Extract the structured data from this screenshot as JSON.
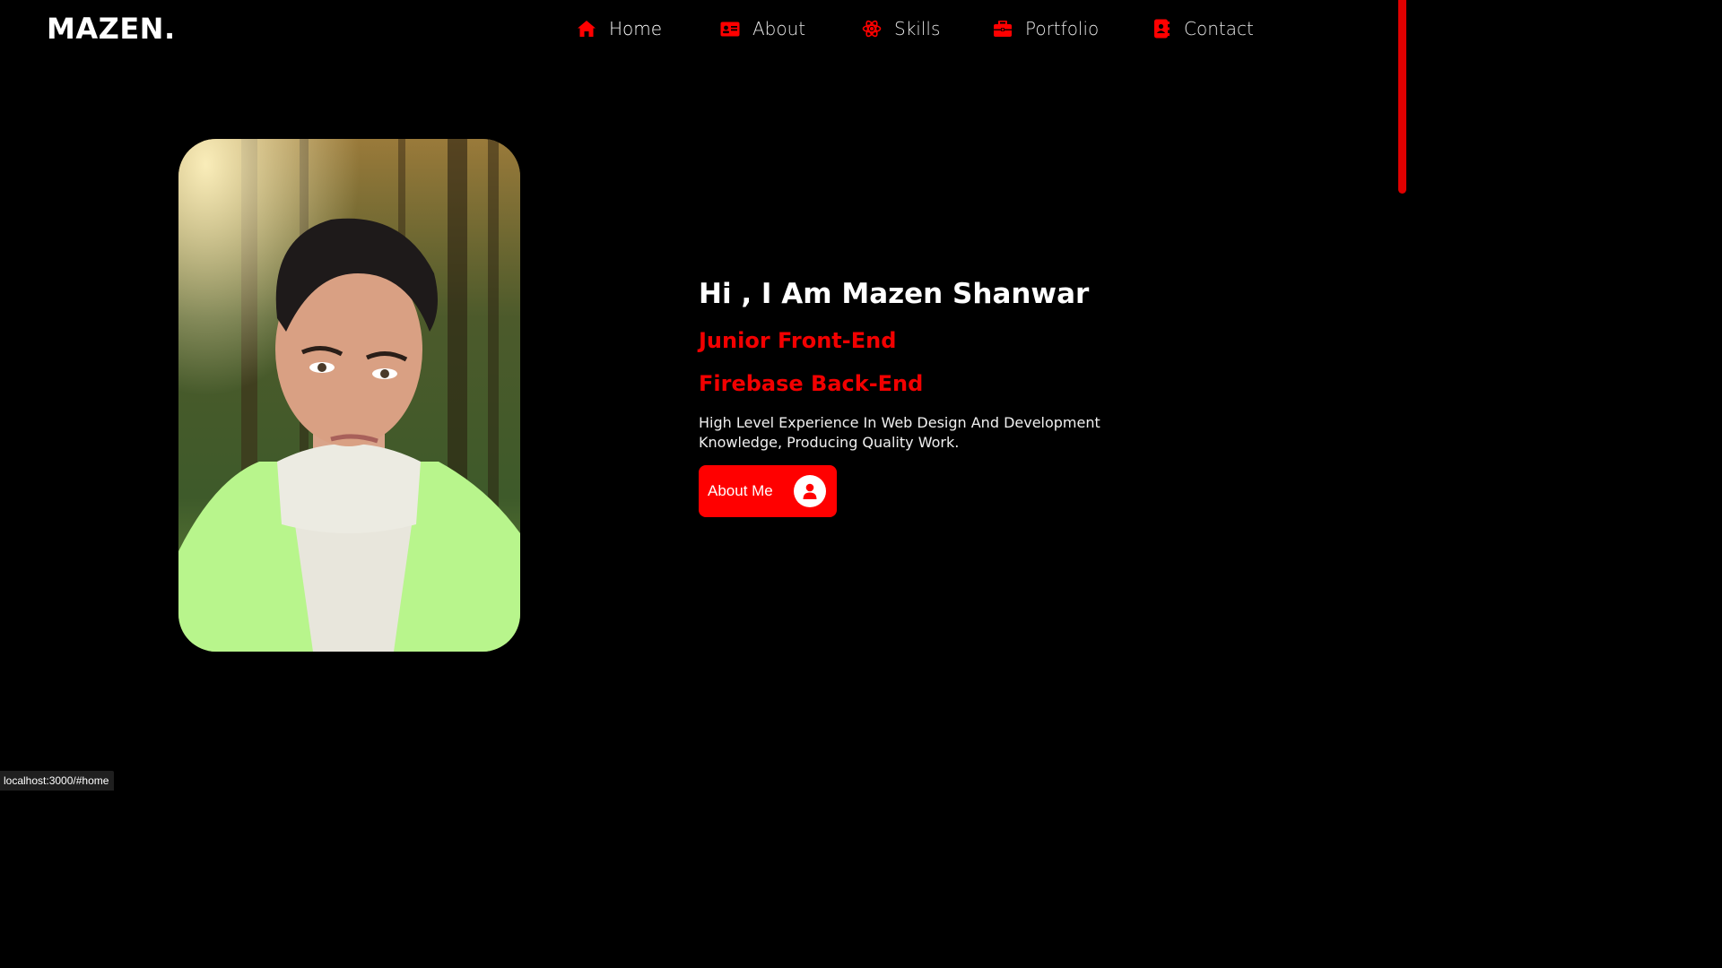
{
  "brand": {
    "logo": "MAZEN."
  },
  "nav": {
    "items": [
      {
        "label": "Home",
        "icon": "home-icon",
        "active": true
      },
      {
        "label": "About",
        "icon": "id-card-icon",
        "active": false
      },
      {
        "label": "Skills",
        "icon": "atom-icon",
        "active": false
      },
      {
        "label": "Portfolio",
        "icon": "briefcase-icon",
        "active": false
      },
      {
        "label": "Contact",
        "icon": "contact-book-icon",
        "active": false
      }
    ]
  },
  "hero": {
    "title": "Hi , I Am Mazen Shanwar",
    "roles": [
      "Junior Front-End",
      "Firebase Back-End"
    ],
    "description": "High Level Experience In Web Design And Development Knowledge, Producing Quality Work.",
    "cta_label": "About Me",
    "cta_icon": "user-icon"
  },
  "status_bar": {
    "url": "localhost:3000/#home"
  },
  "colors": {
    "accent": "#ff0000",
    "background": "#000000",
    "text": "#ffffff"
  }
}
